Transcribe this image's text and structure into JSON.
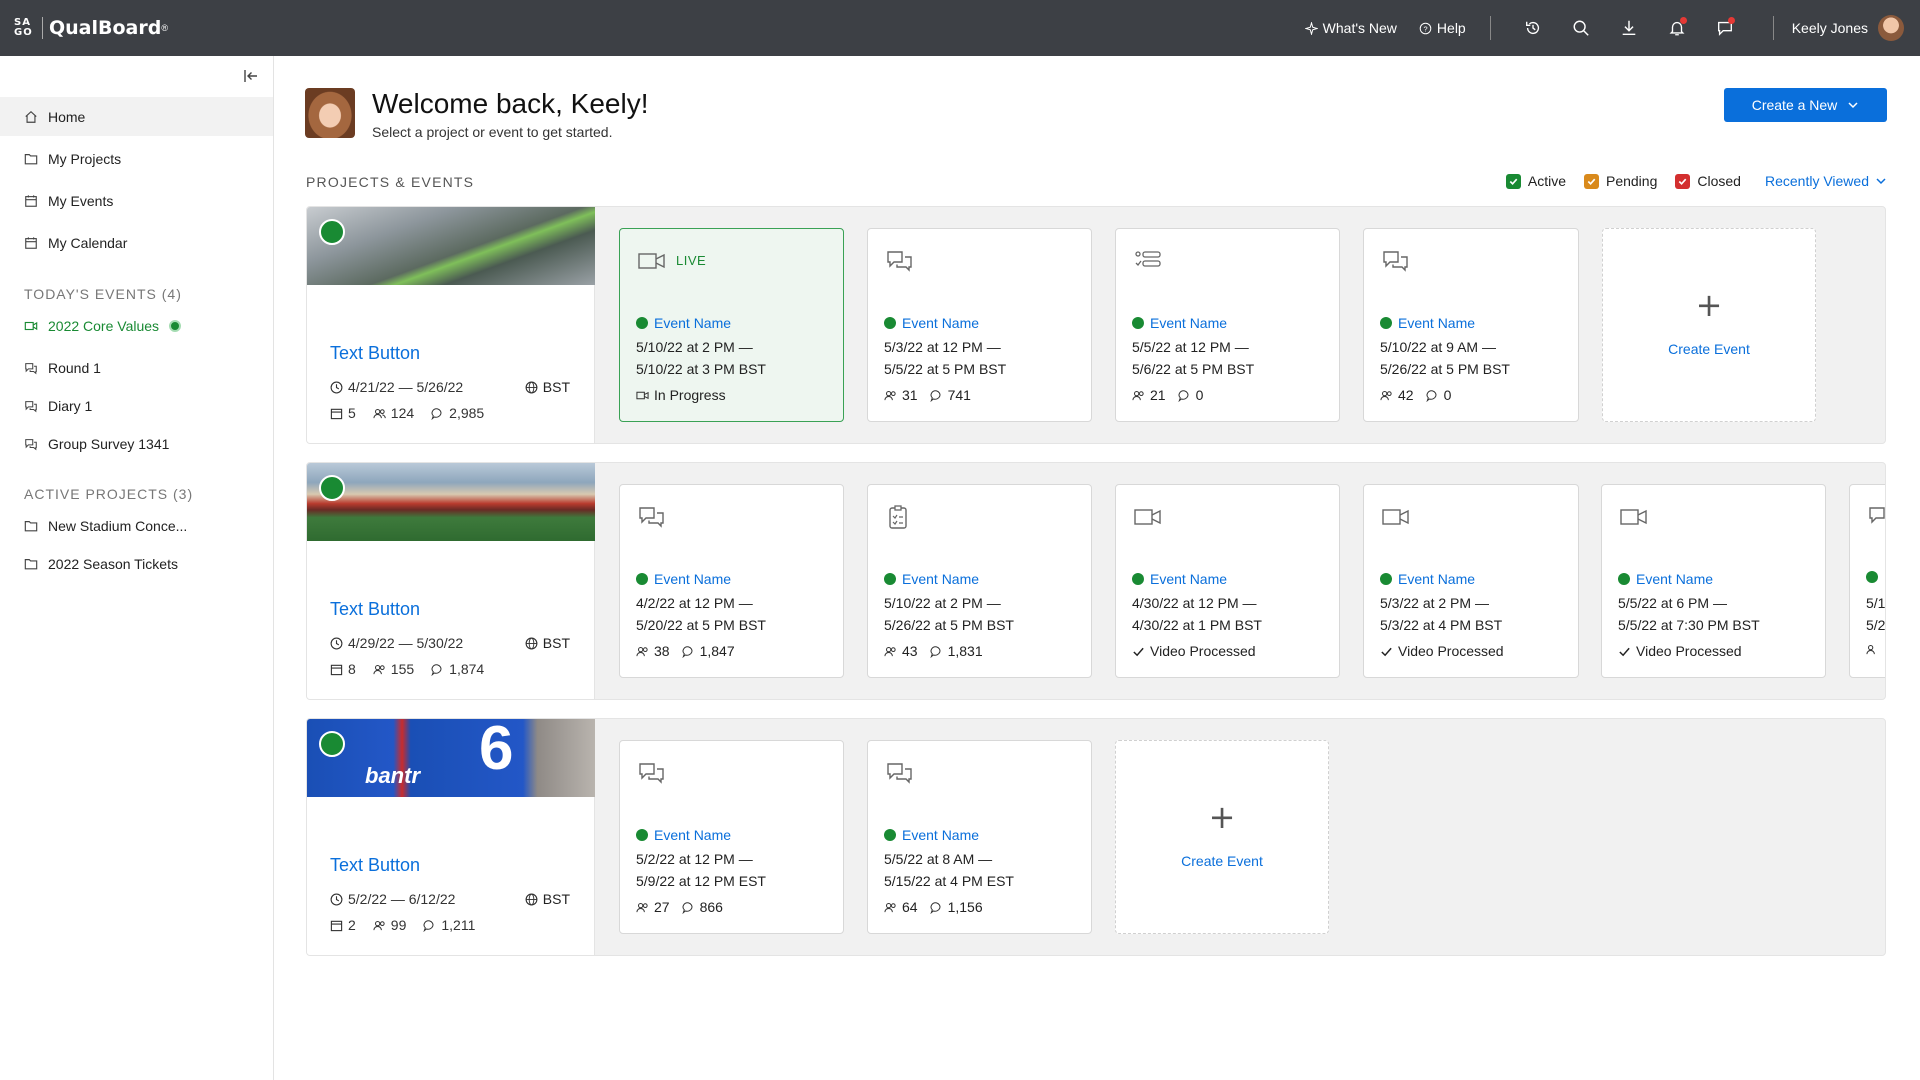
{
  "app": {
    "logo_mark": "SA GO",
    "name": "QualBoard",
    "trademark": "®"
  },
  "topbar": {
    "whats_new": "What's New",
    "help": "Help",
    "user_name": "Keely Jones"
  },
  "sidebar": {
    "nav": [
      {
        "label": "Home",
        "icon": "home-icon"
      },
      {
        "label": "My Projects",
        "icon": "folder-icon"
      },
      {
        "label": "My Events",
        "icon": "calendar-icon"
      },
      {
        "label": "My Calendar",
        "icon": "calendar-icon"
      }
    ],
    "todays_events_header": "TODAY'S EVENTS (4)",
    "todays_events": [
      "2022 Core Values",
      "Round 1",
      "Diary 1",
      "Group Survey 1341"
    ],
    "active_projects_header": "ACTIVE PROJECTS (3)",
    "active_projects": [
      "New Stadium Conce...",
      "2022 Season Tickets"
    ]
  },
  "main": {
    "welcome_title": "Welcome back, Keely!",
    "welcome_sub": "Select a project or event to get started.",
    "create_new": "Create a New",
    "section_label": "PROJECTS & EVENTS",
    "filters": [
      {
        "label": "Active",
        "color": "#198a33"
      },
      {
        "label": "Pending",
        "color": "#d98a1c"
      },
      {
        "label": "Closed",
        "color": "#d32f2f"
      }
    ],
    "sort": "Recently Viewed"
  },
  "projects": [
    {
      "title": "Text Button",
      "dates": "4/21/22 — 5/26/22",
      "tz": "BST",
      "events": "5",
      "participants": "124",
      "comments": "2,985",
      "cards": [
        {
          "live": "LIVE",
          "name": "Event Name",
          "d1": "5/10/22 at 2 PM —",
          "d2": "5/10/22 at 3 PM BST",
          "status": "In Progress"
        },
        {
          "name": "Event Name",
          "d1": "5/3/22 at 12 PM —",
          "d2": "5/5/22 at 5 PM BST",
          "p": "31",
          "c": "741"
        },
        {
          "name": "Event Name",
          "d1": "5/5/22 at 12 PM —",
          "d2": "5/6/22 at 5 PM BST",
          "p": "21",
          "c": "0"
        },
        {
          "name": "Event Name",
          "d1": "5/10/22 at 9 AM —",
          "d2": "5/26/22 at 5 PM BST",
          "p": "42",
          "c": "0"
        }
      ],
      "create_label": "Create Event"
    },
    {
      "title": "Text Button",
      "dates": "4/29/22 — 5/30/22",
      "tz": "BST",
      "events": "8",
      "participants": "155",
      "comments": "1,874",
      "cards": [
        {
          "name": "Event Name",
          "d1": "4/2/22 at 12 PM —",
          "d2": "5/20/22 at 5 PM BST",
          "p": "38",
          "c": "1,847"
        },
        {
          "name": "Event Name",
          "d1": "5/10/22 at 2 PM —",
          "d2": "5/26/22 at 5 PM BST",
          "p": "43",
          "c": "1,831"
        },
        {
          "name": "Event Name",
          "d1": "4/30/22 at 12 PM —",
          "d2": "4/30/22 at 1 PM BST",
          "status": "Video Processed"
        },
        {
          "name": "Event Name",
          "d1": "5/3/22 at 2 PM —",
          "d2": "5/3/22 at 4 PM BST",
          "status": "Video Processed"
        },
        {
          "name": "Event Name",
          "d1": "5/5/22 at 6 PM —",
          "d2": "5/5/22 at 7:30 PM BST",
          "status": "Video Processed"
        },
        {
          "d1": "5/1",
          "d2": "5/2"
        }
      ]
    },
    {
      "title": "Text Button",
      "dates": "5/2/22 — 6/12/22",
      "tz": "BST",
      "events": "2",
      "participants": "99",
      "comments": "1,211",
      "jersey_text": "bantr",
      "jersey_num": "6",
      "cards": [
        {
          "name": "Event Name",
          "d1": "5/2/22 at 12 PM —",
          "d2": "5/9/22 at 12 PM EST",
          "p": "27",
          "c": "866"
        },
        {
          "name": "Event Name",
          "d1": "5/5/22 at 8 AM —",
          "d2": "5/15/22 at 4 PM EST",
          "p": "64",
          "c": "1,156"
        }
      ],
      "create_label": "Create Event"
    }
  ]
}
